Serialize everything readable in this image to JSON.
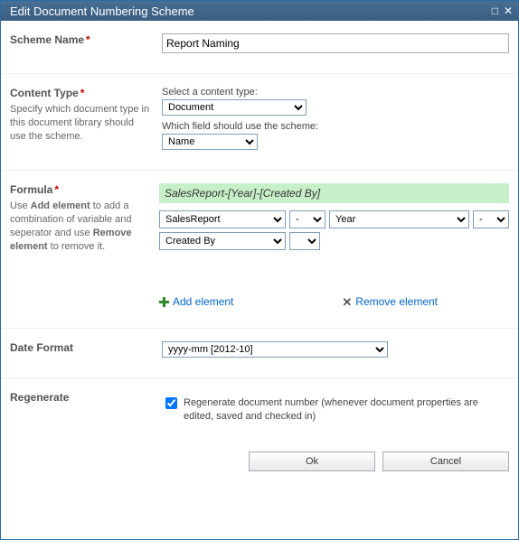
{
  "dialog": {
    "title": "Edit Document Numbering Scheme"
  },
  "scheme_name": {
    "heading": "Scheme Name",
    "value": "Report Naming"
  },
  "content_type": {
    "heading": "Content Type",
    "desc": "Specify which document type in this document library should use the scheme.",
    "select_label": "Select a content type:",
    "select_value": "Document",
    "field_label": "Which field should use the scheme:",
    "field_value": "Name"
  },
  "formula": {
    "heading": "Formula",
    "desc_1": "Use ",
    "desc_bold1": "Add element",
    "desc_2": " to add a combination of variable and seperator and use ",
    "desc_bold2": "Remove element",
    "desc_3": " to remove it.",
    "preview": "SalesReport-[Year]-[Created By]",
    "row1_el1": "SalesReport",
    "row1_sep1": "-",
    "row1_el2": "Year",
    "row1_sep2": "-",
    "row2_el1": "Created By",
    "row2_sep1": "",
    "add_label": "Add element",
    "remove_label": "Remove element"
  },
  "date_format": {
    "heading": "Date Format",
    "value": "yyyy-mm [2012-10]"
  },
  "regenerate": {
    "heading": "Regenerate",
    "checked": true,
    "label": "Regenerate document number (whenever document properties are edited, saved and checked in)"
  },
  "buttons": {
    "ok": "Ok",
    "cancel": "Cancel"
  }
}
